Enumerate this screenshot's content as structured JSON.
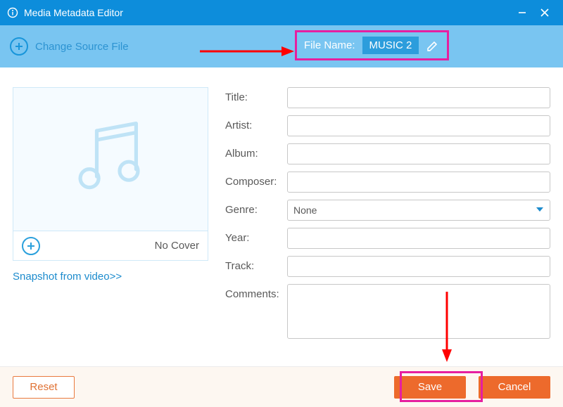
{
  "window": {
    "title": "Media Metadata Editor"
  },
  "toolbar": {
    "change_source": "Change Source File",
    "filename_label": "File Name:",
    "filename_value": "MUSIC 2"
  },
  "cover": {
    "no_cover": "No Cover",
    "snapshot_link": "Snapshot from video>>"
  },
  "form": {
    "title_label": "Title:",
    "artist_label": "Artist:",
    "album_label": "Album:",
    "composer_label": "Composer:",
    "genre_label": "Genre:",
    "genre_value": "None",
    "year_label": "Year:",
    "track_label": "Track:",
    "comments_label": "Comments:",
    "values": {
      "title": "",
      "artist": "",
      "album": "",
      "composer": "",
      "year": "",
      "track": "",
      "comments": ""
    }
  },
  "footer": {
    "reset": "Reset",
    "save": "Save",
    "cancel": "Cancel"
  }
}
